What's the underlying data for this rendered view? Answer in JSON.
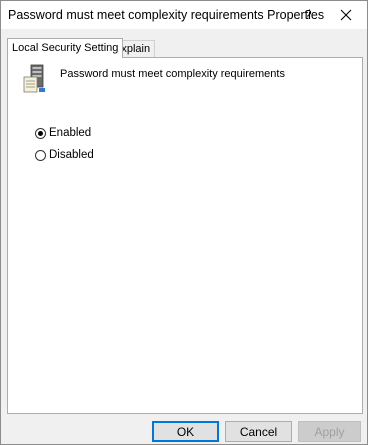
{
  "window": {
    "title": "Password must meet complexity requirements Properties",
    "help_label": "?"
  },
  "tabs": [
    {
      "label": "Local Security Setting",
      "active": true
    },
    {
      "label": "Explain",
      "active": false
    }
  ],
  "policy": {
    "icon": "server-policy-icon",
    "name": "Password must meet complexity requirements"
  },
  "options": [
    {
      "label": "Enabled",
      "selected": true
    },
    {
      "label": "Disabled",
      "selected": false
    }
  ],
  "buttons": {
    "ok": "OK",
    "cancel": "Cancel",
    "apply": "Apply",
    "apply_enabled": false
  },
  "colors": {
    "default_button_border": "#0078d7",
    "dialog_background": "#f0f0f0"
  }
}
